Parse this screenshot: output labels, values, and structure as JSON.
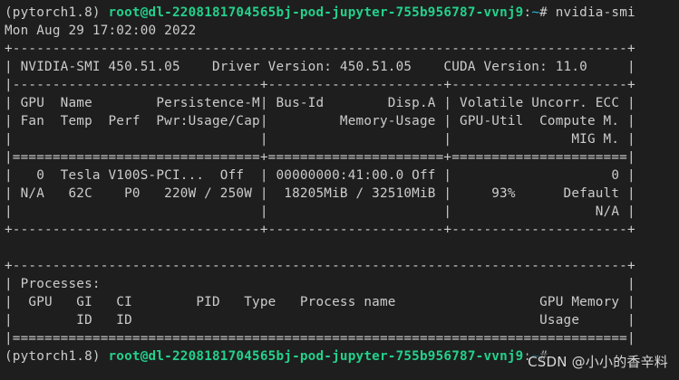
{
  "prompt": {
    "env": "(pytorch1.8) ",
    "user_host": "root@dl-2208181704565bj-pod-jupyter-755b956787-vvnj9",
    "colon": ":",
    "path": "~",
    "symbol": "# ",
    "command": "nvidia-smi"
  },
  "timestamp": "Mon Aug 29 17:02:00 2022",
  "lines": [
    "+-----------------------------------------------------------------------------+",
    "| NVIDIA-SMI 450.51.05    Driver Version: 450.51.05    CUDA Version: 11.0     |",
    "|-------------------------------+----------------------+----------------------+",
    "| GPU  Name        Persistence-M| Bus-Id        Disp.A | Volatile Uncorr. ECC |",
    "| Fan  Temp  Perf  Pwr:Usage/Cap|         Memory-Usage | GPU-Util  Compute M. |",
    "|                               |                      |               MIG M. |",
    "|===============================+======================+======================|",
    "|   0  Tesla V100S-PCI...  Off  | 00000000:41:00.0 Off |                    0 |",
    "| N/A   62C    P0   220W / 250W |  18205MiB / 32510MiB |     93%      Default |",
    "|                               |                      |                  N/A |",
    "+-------------------------------+----------------------+----------------------+",
    "",
    "+-----------------------------------------------------------------------------+",
    "| Processes:                                                                  |",
    "|  GPU   GI   CI        PID   Type   Process name                  GPU Memory |",
    "|        ID   ID                                                   Usage      |",
    "|=============================================================================|"
  ],
  "next_prompt": {
    "env": "(pytorch1.8) ",
    "user_host": "root@dl-2208181704565bj-pod-jupyter-755b956787-vvnj9",
    "colon": ":",
    "path": "~",
    "symbol": "# "
  },
  "watermark": "CSDN @小小的香辛料"
}
